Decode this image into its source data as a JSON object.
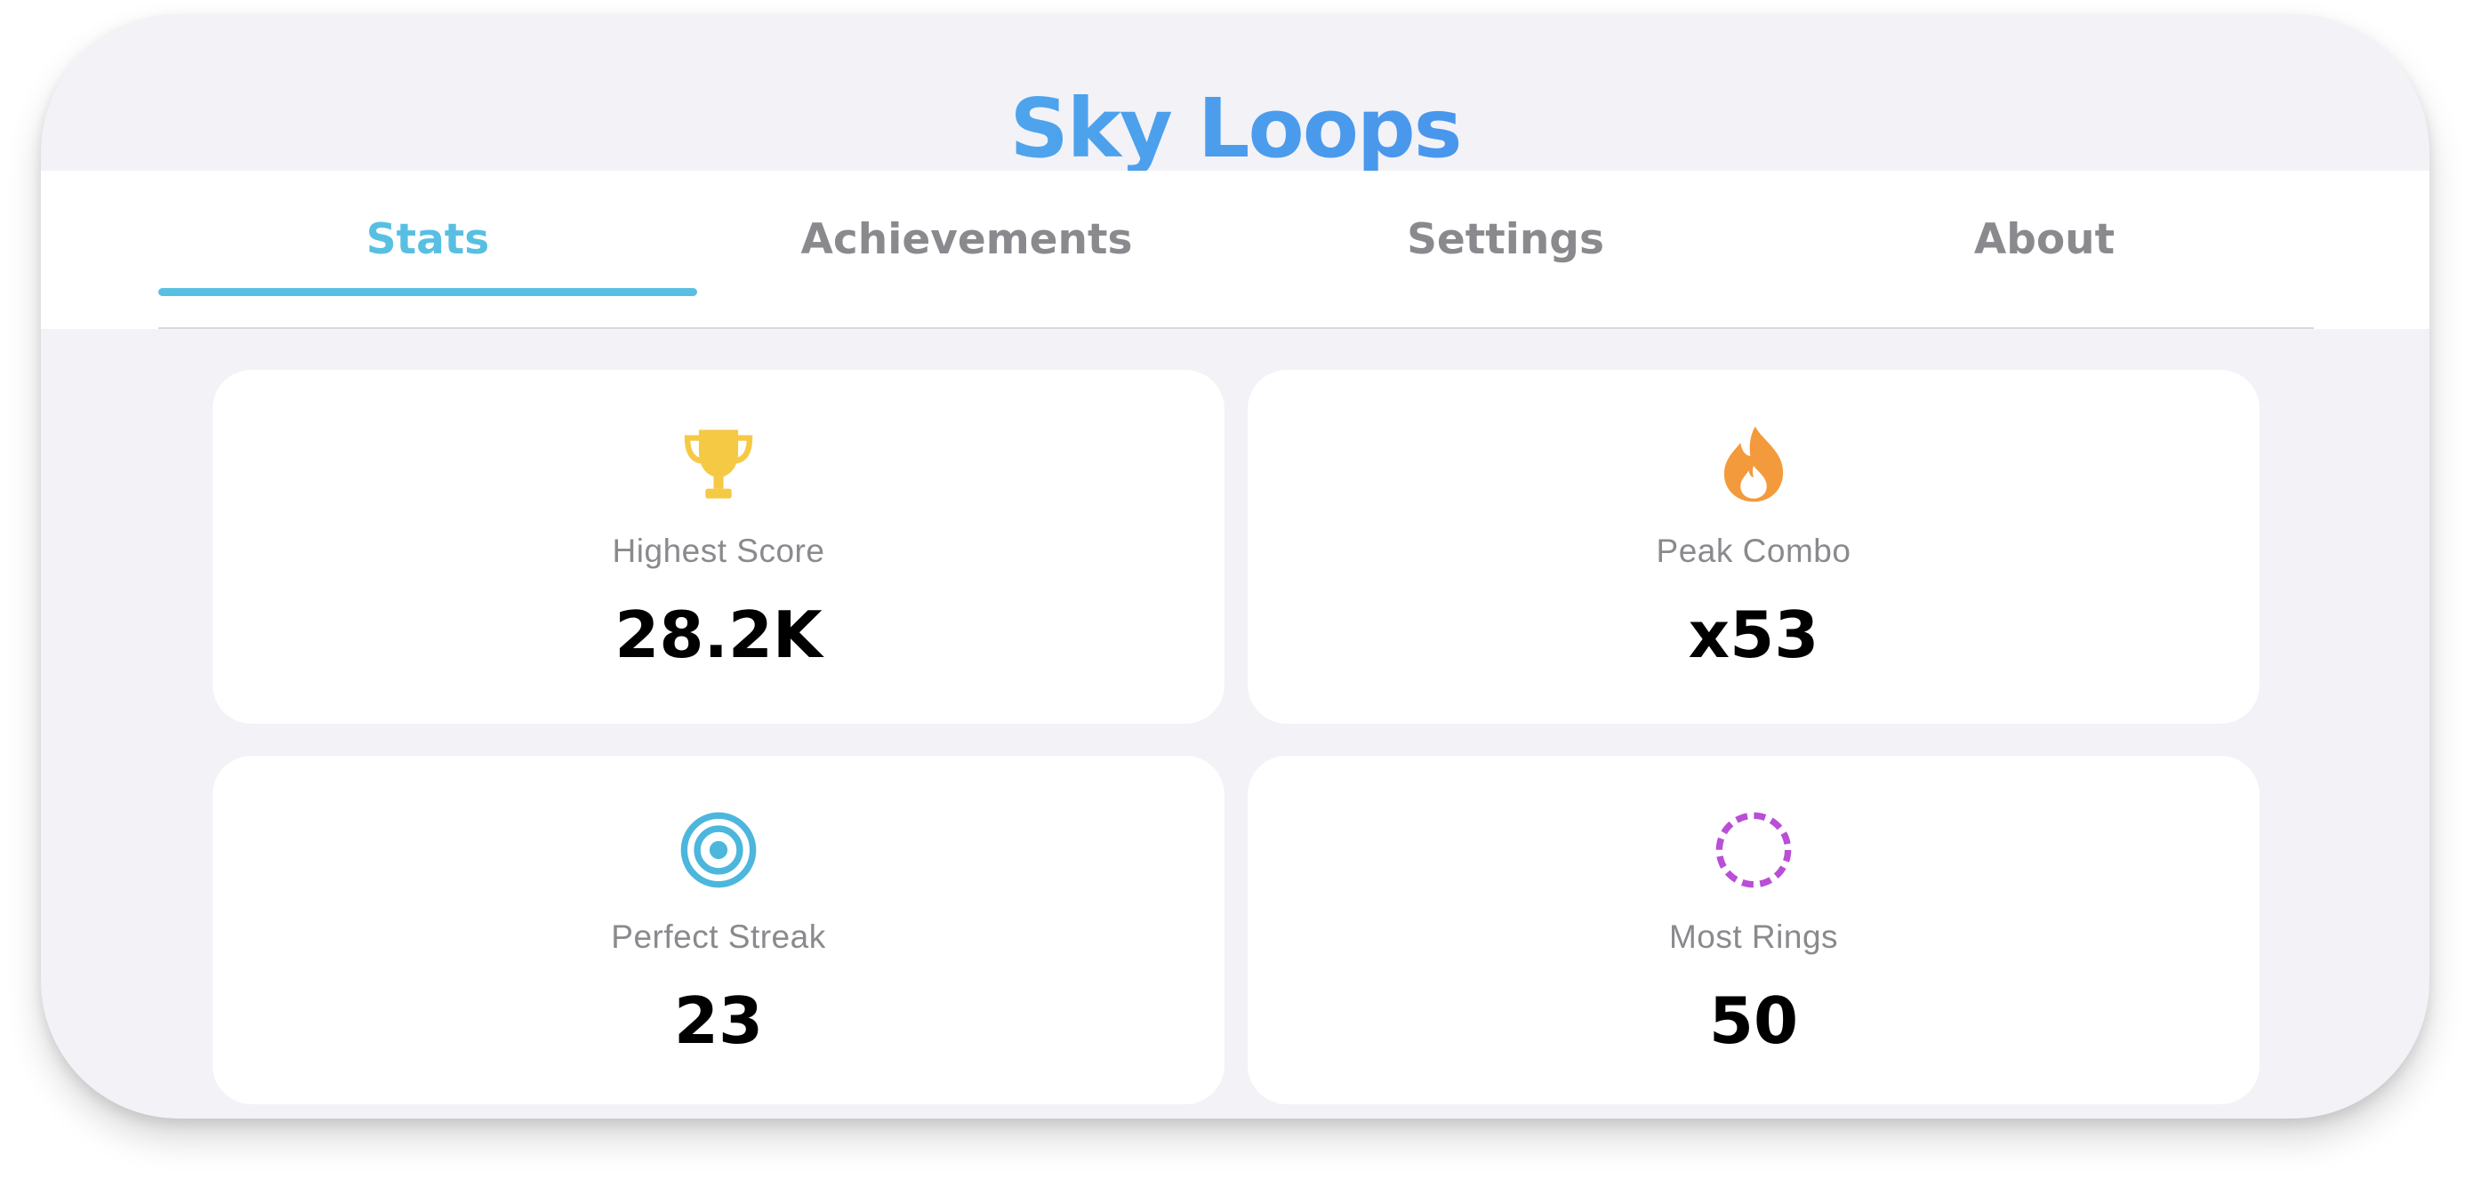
{
  "app": {
    "title": "Sky Loops"
  },
  "tabs": [
    {
      "label": "Stats",
      "active": true
    },
    {
      "label": "Achievements",
      "active": false
    },
    {
      "label": "Settings",
      "active": false
    },
    {
      "label": "About",
      "active": false
    }
  ],
  "stats": [
    {
      "label": "Highest Score",
      "value": "28.2K",
      "icon": "trophy-icon",
      "color": "#f6c945"
    },
    {
      "label": "Peak Combo",
      "value": "x53",
      "icon": "flame-icon",
      "color": "#f39a3c"
    },
    {
      "label": "Perfect Streak",
      "value": "23",
      "icon": "target-icon",
      "color": "#4cb6dd"
    },
    {
      "label": "Most Rings",
      "value": "50",
      "icon": "dashed-ring-icon",
      "color": "#b94fd6"
    }
  ],
  "colors": {
    "accent": "#58bfe3",
    "background": "#f2f2f7",
    "card": "#ffffff",
    "inactive_tab": "#8a8a8e"
  }
}
